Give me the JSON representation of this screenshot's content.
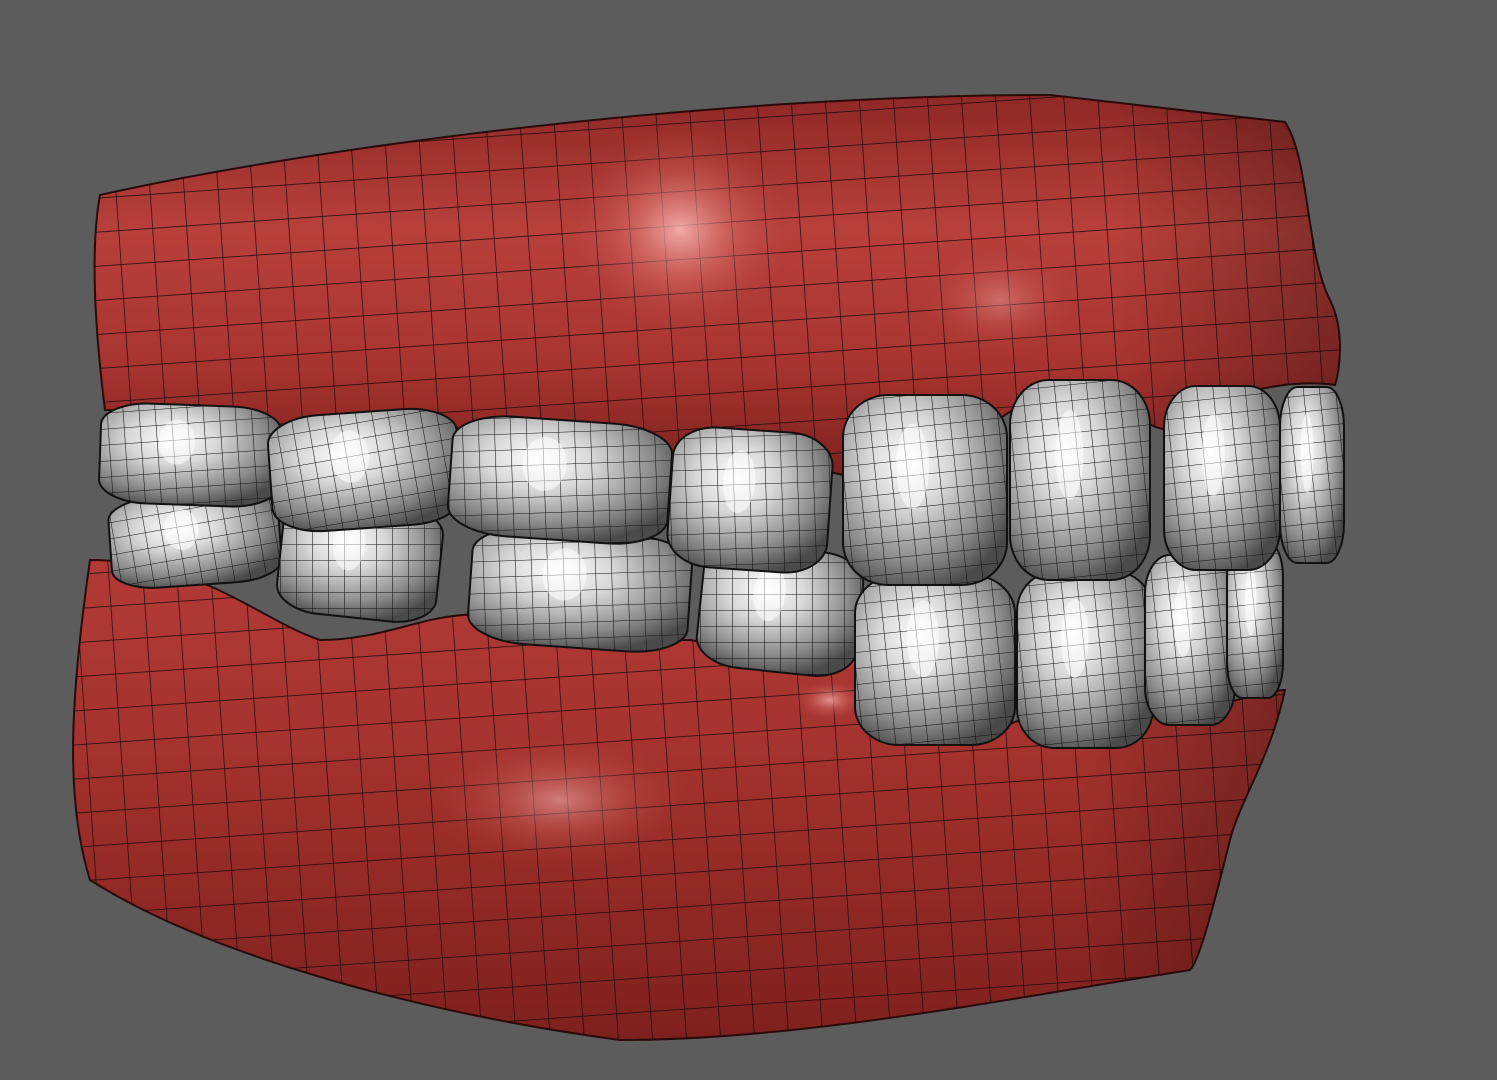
{
  "scene": {
    "subject": "dental-model-wireframe-render",
    "colors": {
      "background": "#5c5c5c",
      "gum": "#a8332f",
      "gum_shadow": "#6e1c1a",
      "gum_highlight": "#f0a3a0",
      "tooth": "#c9c9c9",
      "tooth_shadow": "#5a5a5a",
      "tooth_highlight": "#ffffff",
      "wire": "#1a0a0a"
    },
    "upper_teeth_count": 8,
    "lower_teeth_count": 8
  }
}
